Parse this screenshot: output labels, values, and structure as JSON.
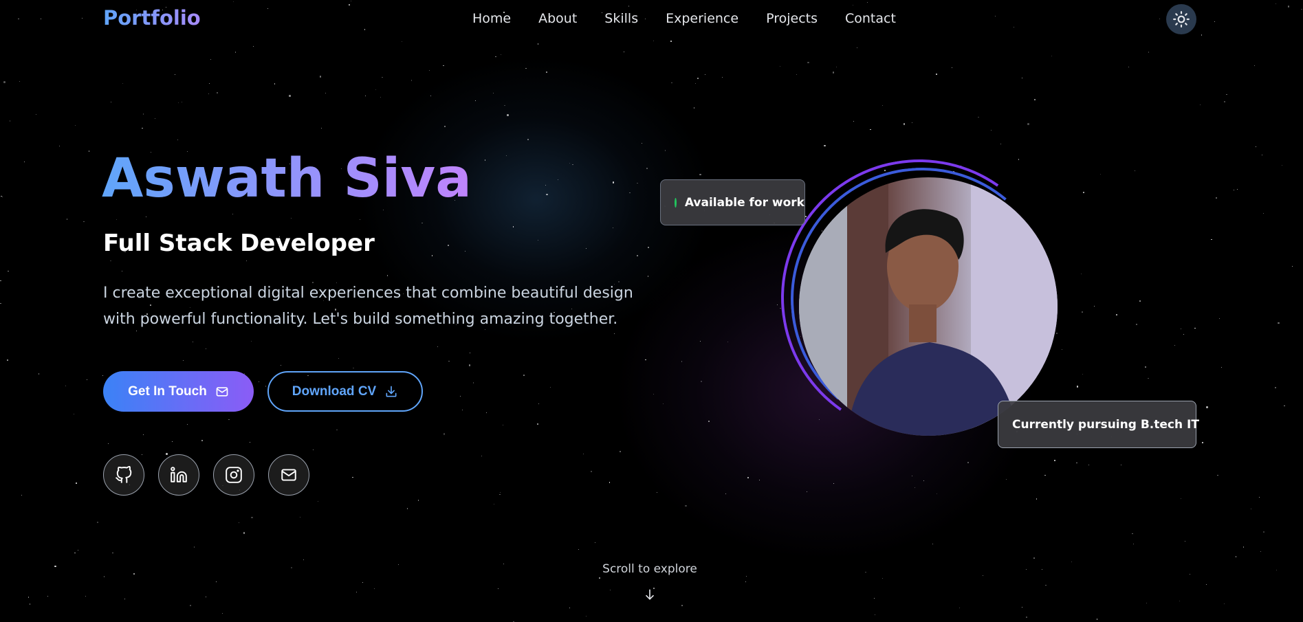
{
  "nav": {
    "logo": "Portfolio",
    "items": [
      {
        "label": "Home"
      },
      {
        "label": "About"
      },
      {
        "label": "Skills"
      },
      {
        "label": "Experience"
      },
      {
        "label": "Projects"
      },
      {
        "label": "Contact"
      }
    ],
    "theme_toggle_icon": "sun-icon"
  },
  "hero": {
    "name": "Aswath Siva",
    "role": "Full Stack Developer",
    "description": "I create exceptional digital experiences that combine beautiful design with powerful functionality. Let's build something amazing together.",
    "primary_button": {
      "label": "Get In Touch",
      "icon": "mail-icon"
    },
    "secondary_button": {
      "label": "Download CV",
      "icon": "download-icon"
    },
    "socials": [
      {
        "icon": "github-icon"
      },
      {
        "icon": "linkedin-icon"
      },
      {
        "icon": "instagram-icon"
      },
      {
        "icon": "mail-icon"
      }
    ]
  },
  "badges": {
    "available": "Available for work",
    "study": "Currently pursuing B.tech IT"
  },
  "scroll": {
    "label": "Scroll to explore",
    "icon": "arrow-down-icon"
  },
  "colors": {
    "accent_blue": "#60a5fa",
    "accent_purple": "#a78bfa",
    "status_green": "#22c55e",
    "status_blue": "#3b82f6",
    "background": "#000000"
  }
}
